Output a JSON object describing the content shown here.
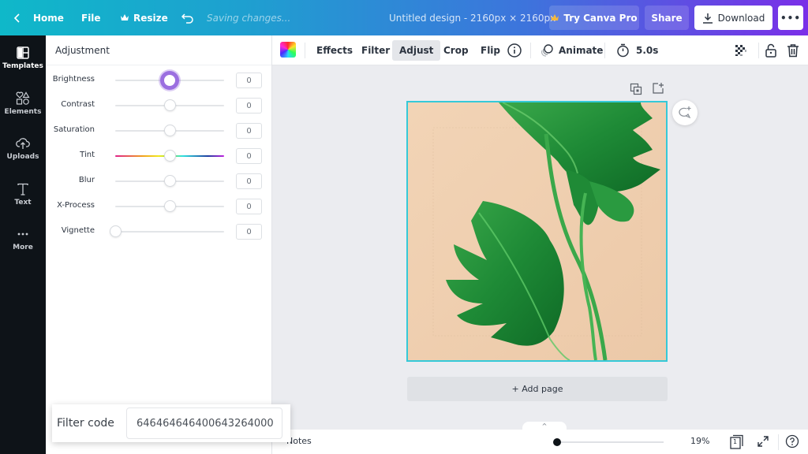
{
  "topbar": {
    "home_label": "Home",
    "file_label": "File",
    "resize_label": "Resize",
    "saving_status": "Saving changes...",
    "design_title": "Untitled design - 2160px × 2160px",
    "try_pro_label": "Try Canva Pro",
    "share_label": "Share",
    "download_label": "Download",
    "more_label": "•••"
  },
  "rail": {
    "items": [
      {
        "label": "Templates",
        "icon": "templates-icon"
      },
      {
        "label": "Elements",
        "icon": "elements-icon"
      },
      {
        "label": "Uploads",
        "icon": "uploads-icon"
      },
      {
        "label": "Text",
        "icon": "text-icon"
      },
      {
        "label": "More",
        "icon": "more-icon"
      }
    ]
  },
  "panel": {
    "title": "Adjustment",
    "adjustments": [
      {
        "label": "Brightness",
        "value": "0",
        "position": 0.5,
        "active": true
      },
      {
        "label": "Contrast",
        "value": "0",
        "position": 0.5,
        "active": false
      },
      {
        "label": "Saturation",
        "value": "0",
        "position": 0.5,
        "active": false
      },
      {
        "label": "Tint",
        "value": "0",
        "position": 0.5,
        "active": false
      },
      {
        "label": "Blur",
        "value": "0",
        "position": 0.5,
        "active": false
      },
      {
        "label": "X-Process",
        "value": "0",
        "position": 0.5,
        "active": false
      },
      {
        "label": "Vignette",
        "value": "0",
        "position": 0.0,
        "active": false
      }
    ],
    "filter_code_label": "Filter code",
    "filter_code_value": "646464646400643264000"
  },
  "toolbar": {
    "effects_label": "Effects",
    "filter_label": "Filter",
    "adjust_label": "Adjust",
    "crop_label": "Crop",
    "flip_label": "Flip",
    "animate_label": "Animate",
    "duration_label": "5.0s"
  },
  "canvas": {
    "add_page_label": "+ Add page"
  },
  "footer": {
    "notes_label": "Notes",
    "zoom_value": "19%",
    "zoom_fraction": 0.0,
    "page_count": "1",
    "collapse_glyph": "^"
  },
  "colors": {
    "accent_selection": "#35c9d8",
    "slider_active": "#9b6fe0",
    "rail_bg": "#0e1318"
  }
}
